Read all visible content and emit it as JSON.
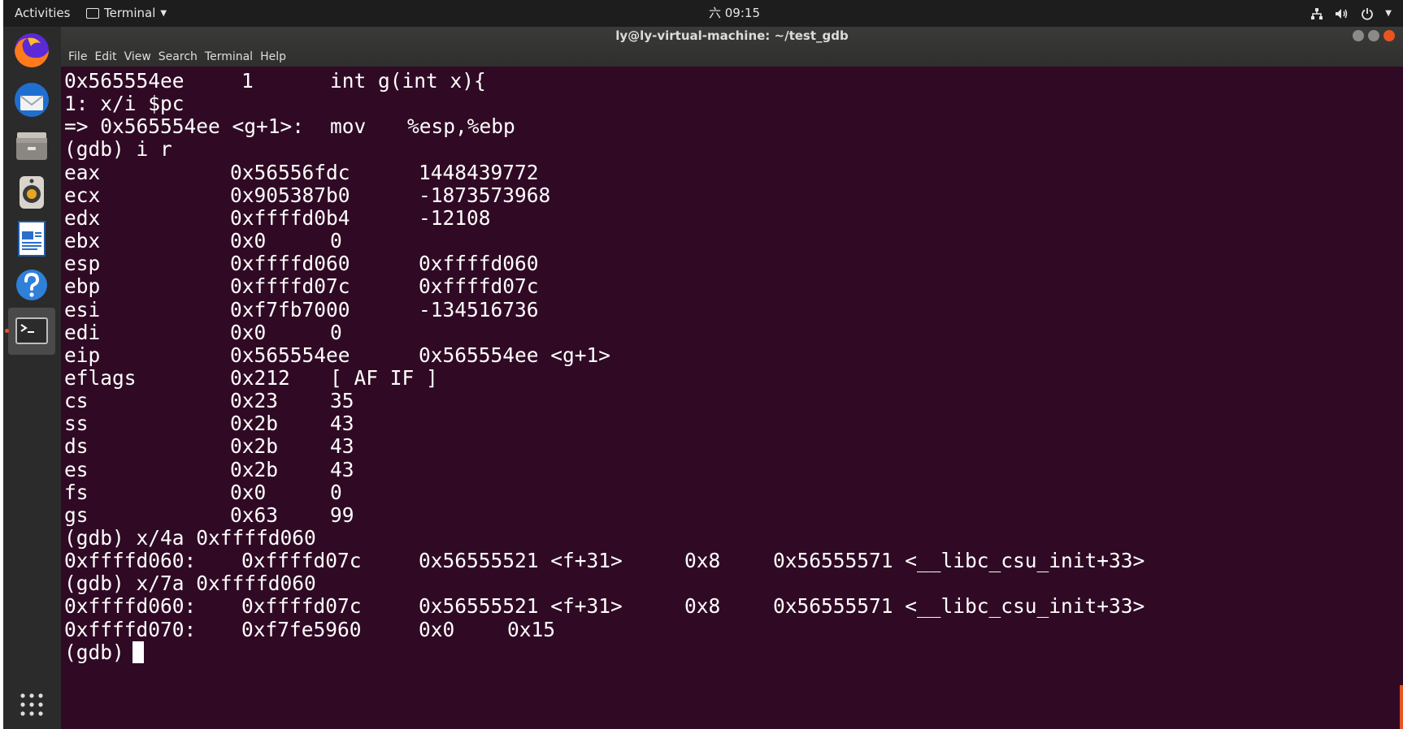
{
  "topbar": {
    "activities": "Activities",
    "app_name": "Terminal",
    "clock": "六 09:15"
  },
  "dock": {
    "items": [
      {
        "icon": "firefox-icon"
      },
      {
        "icon": "thunderbird-icon"
      },
      {
        "icon": "files-icon"
      },
      {
        "icon": "rhythmbox-icon"
      },
      {
        "icon": "libreoffice-writer-icon"
      },
      {
        "icon": "help-icon"
      },
      {
        "icon": "terminal-icon",
        "active": true
      }
    ],
    "apps_grid_icon": "show-applications-icon"
  },
  "window": {
    "title": "ly@ly-virtual-machine: ~/test_gdb",
    "menu": [
      "File",
      "Edit",
      "View",
      "Search",
      "Terminal",
      "Help"
    ]
  },
  "terminal": {
    "lines": [
      [
        "0x565554ee",
        "1",
        "int g(int x){"
      ],
      [
        "1: x/i $pc"
      ],
      [
        "=> 0x565554ee <g+1>:",
        "mov",
        "%esp,%ebp"
      ],
      [
        "(gdb) i r"
      ],
      [
        "eax",
        "0x56556fdc",
        "1448439772"
      ],
      [
        "ecx",
        "0x905387b0",
        "-1873573968"
      ],
      [
        "edx",
        "0xffffd0b4",
        "-12108"
      ],
      [
        "ebx",
        "0x0",
        "0"
      ],
      [
        "esp",
        "0xffffd060",
        "0xffffd060"
      ],
      [
        "ebp",
        "0xffffd07c",
        "0xffffd07c"
      ],
      [
        "esi",
        "0xf7fb7000",
        "-134516736"
      ],
      [
        "edi",
        "0x0",
        "0"
      ],
      [
        "eip",
        "0x565554ee",
        "0x565554ee <g+1>"
      ],
      [
        "eflags",
        "0x212",
        "[ AF IF ]"
      ],
      [
        "cs",
        "0x23",
        "35"
      ],
      [
        "ss",
        "0x2b",
        "43"
      ],
      [
        "ds",
        "0x2b",
        "43"
      ],
      [
        "es",
        "0x2b",
        "43"
      ],
      [
        "fs",
        "0x0",
        "0"
      ],
      [
        "gs",
        "0x63",
        "99"
      ],
      [
        "(gdb) x/4a 0xffffd060"
      ],
      [
        "0xffffd060:",
        "0xffffd07c",
        "0x56555521 <f+31>",
        "0x8",
        "0x56555571 <__libc_csu_init+33>"
      ],
      [
        "(gdb) x/7a 0xffffd060"
      ],
      [
        "0xffffd060:",
        "0xffffd07c",
        "0x56555521 <f+31>",
        "0x8",
        "0x56555571 <__libc_csu_init+33>"
      ],
      [
        "0xffffd070:",
        "0xf7fe5960",
        "0x0",
        "0x15"
      ],
      [
        "(gdb) "
      ]
    ]
  },
  "colors": {
    "terminal_bg": "#300a24",
    "text": "#ffffff",
    "accent": "#e95420"
  }
}
